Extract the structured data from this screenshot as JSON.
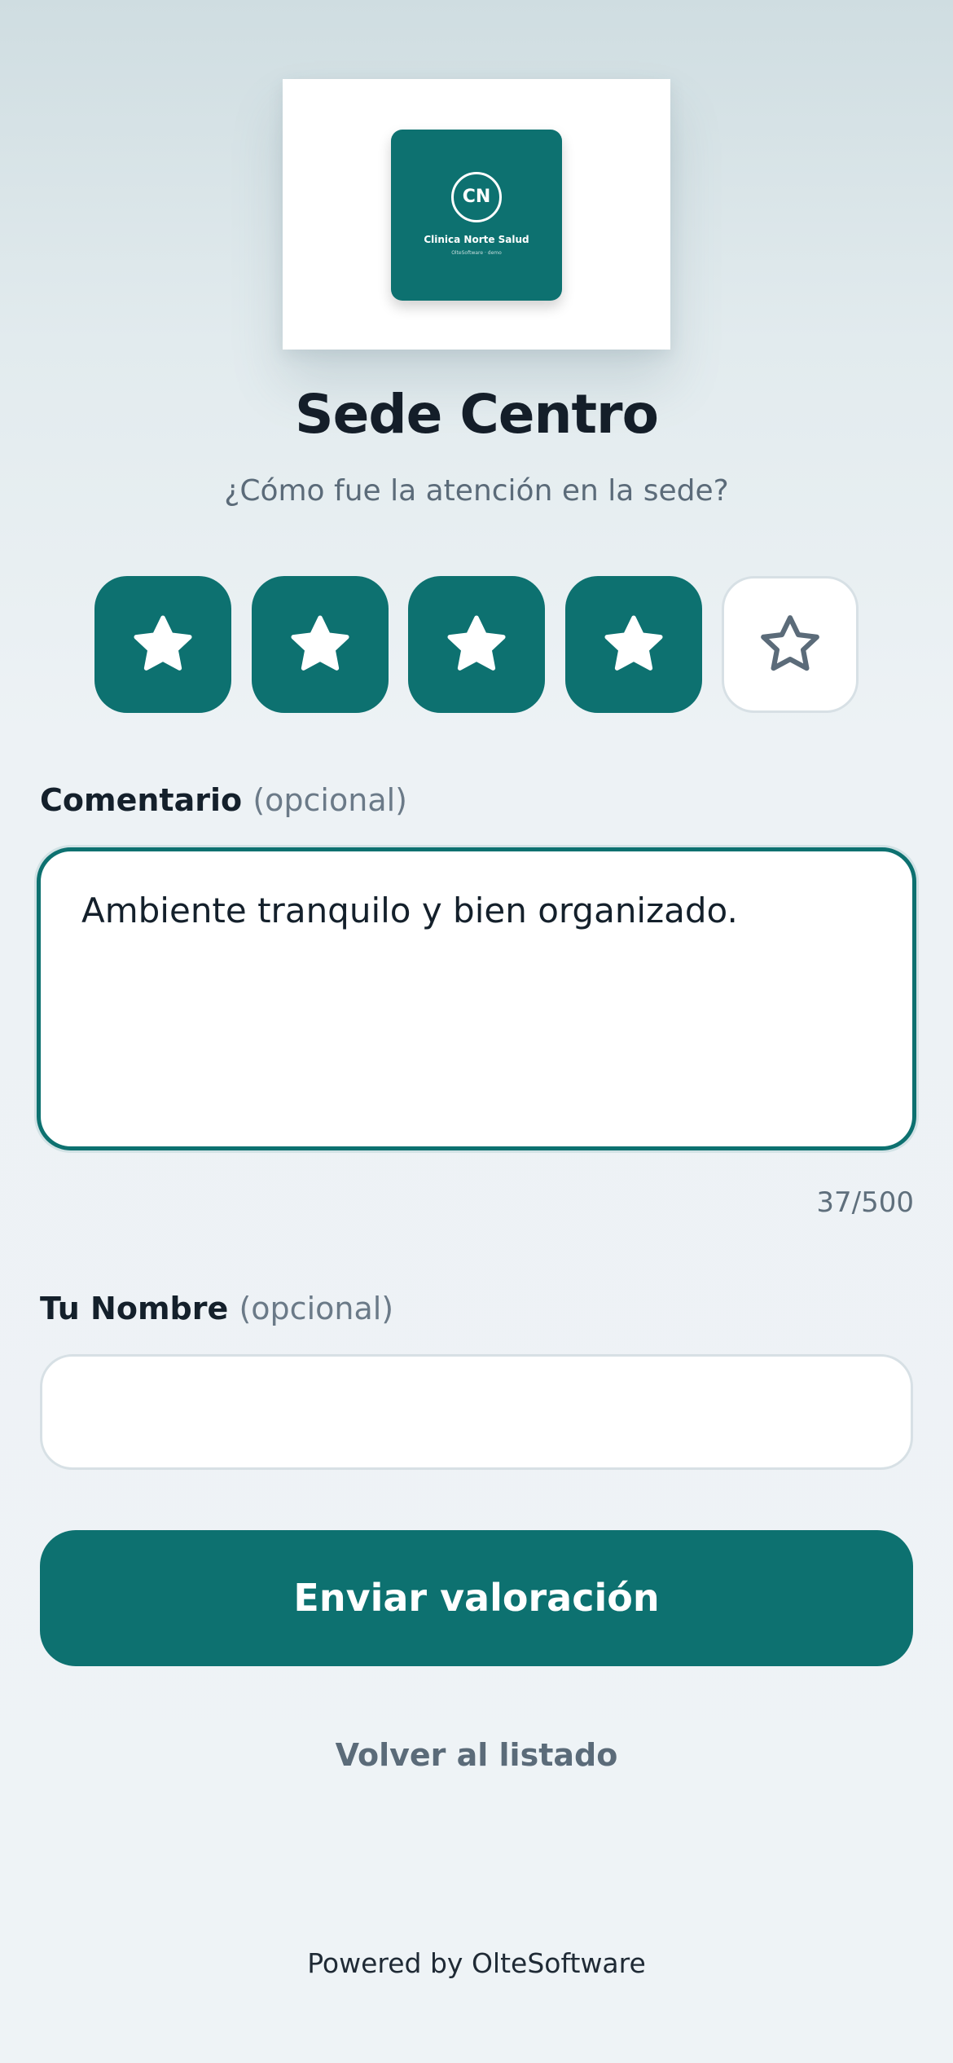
{
  "logo": {
    "initials": "CN",
    "name": "Clinica Norte Salud",
    "sub": "OlteSoftware · demo"
  },
  "header": {
    "title": "Sede Centro",
    "subtitle": "¿Cómo fue la atención en la sede?"
  },
  "rating": {
    "value": 4,
    "max": 5,
    "accent_color": "#0d7170",
    "icon": "star-icon"
  },
  "comment": {
    "label": "Comentario",
    "optional": "(opcional)",
    "value": "Ambiente tranquilo y bien organizado.",
    "counter": "37/500"
  },
  "name_field": {
    "label": "Tu Nombre",
    "optional": "(opcional)",
    "value": ""
  },
  "actions": {
    "submit_label": "Enviar valoración",
    "back_label": "Volver al listado"
  },
  "footer": {
    "powered_by": "Powered by OlteSoftware"
  }
}
